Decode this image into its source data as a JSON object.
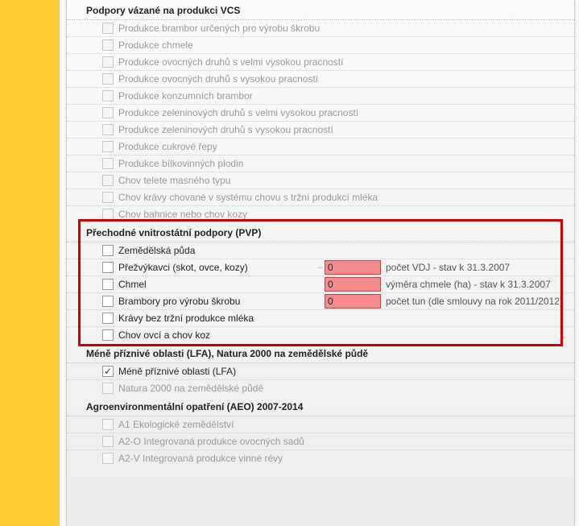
{
  "sections": {
    "vcs": {
      "title": "Podpory vázané na produkci VCS",
      "items": [
        {
          "label": "Produkce brambor určených pro výrobu škrobu"
        },
        {
          "label": "Produkce chmele"
        },
        {
          "label": "Produkce ovocných druhů s velmi vysokou pracností"
        },
        {
          "label": "Produkce ovocných druhů s vysokou pracností"
        },
        {
          "label": "Produkce konzumních brambor"
        },
        {
          "label": "Produkce zeleninových druhů s velmi vysokou pracností"
        },
        {
          "label": "Produkce zeleninových druhů s vysokou pracností"
        },
        {
          "label": "Produkce cukrové řepy"
        },
        {
          "label": "Produkce bílkovinných plodin"
        },
        {
          "label": "Chov telete masného typu"
        },
        {
          "label": "Chov krávy chované v systému chovu s tržní produkcí mléka"
        },
        {
          "label": "Chov bahnice nebo chov kozy"
        }
      ]
    },
    "pvp": {
      "title": "Přechodné vnitrostátní podpory (PVP)",
      "items": [
        {
          "label": "Zemědělská půda",
          "input": null
        },
        {
          "label": "Přežvýkavci (skot, ovce, kozy)",
          "input": {
            "value": "0",
            "suffix": "počet VDJ - stav k 31.3.2007",
            "quest": true
          }
        },
        {
          "label": "Chmel",
          "input": {
            "value": "0",
            "suffix": "výměra chmele (ha) - stav k 31.3.2007"
          }
        },
        {
          "label": "Brambory pro výrobu škrobu",
          "input": {
            "value": "0",
            "suffix": "počet tun (dle smlouvy na rok 2011/2012)"
          }
        },
        {
          "label": "Krávy bez tržní produkce mléka",
          "input": null
        },
        {
          "label": "Chov ovcí a chov koz",
          "input": null
        }
      ]
    },
    "lfa": {
      "title": "Méně příznivé oblasti (LFA), Natura 2000 na zemědělské půdě",
      "items": [
        {
          "label": "Méně příznivé oblasti (LFA)",
          "checked": true,
          "enabled": true
        },
        {
          "label": "Natura 2000 na zemědělské půdě",
          "enabled": false
        }
      ]
    },
    "aeo": {
      "title": "Agroenvironmentální opatření (AEO) 2007-2014",
      "items": [
        {
          "label": "A1 Ekologické zemědělství"
        },
        {
          "label": "A2-O Integrovaná produkce ovocných sadů"
        },
        {
          "label": "A2-V Integrovaná produkce vinné révy"
        }
      ]
    }
  }
}
